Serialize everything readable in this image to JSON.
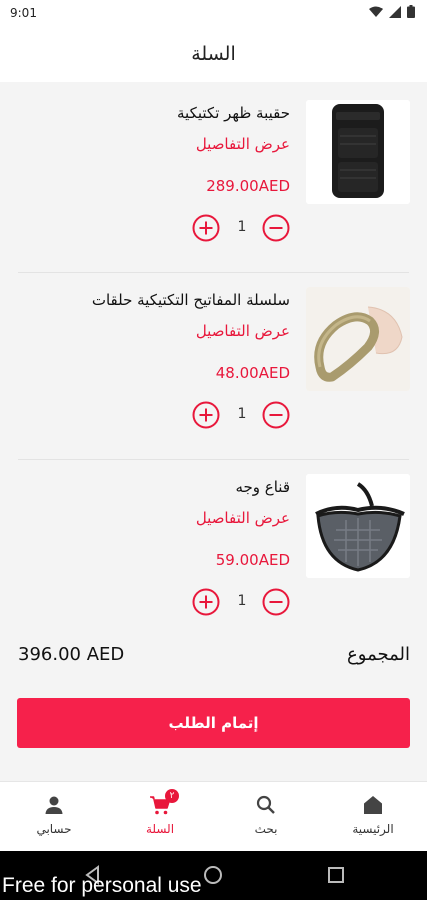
{
  "status_bar": {
    "time": "9:01"
  },
  "header": {
    "title": "السلة"
  },
  "cart": {
    "items": [
      {
        "name": "حقيبة ظهر تكتيكية",
        "details_link": "عرض التفاصيل",
        "price": "289.00AED",
        "quantity": "1"
      },
      {
        "name": "سلسلة المفاتيح التكتيكية حلقات",
        "details_link": "عرض التفاصيل",
        "price": "48.00AED",
        "quantity": "1"
      },
      {
        "name": "قناع وجه",
        "details_link": "عرض التفاصيل",
        "price": "59.00AED",
        "quantity": "1"
      }
    ],
    "total_label": "المجموع",
    "total_value": "396.00 AED",
    "checkout_label": "إتمام الطلب"
  },
  "bottom_nav": {
    "items": [
      {
        "label": "الرئيسية",
        "icon": "home-icon"
      },
      {
        "label": "بحث",
        "icon": "search-icon"
      },
      {
        "label": "السلة",
        "icon": "cart-icon",
        "badge": "٢",
        "active": true
      },
      {
        "label": "حسابي",
        "icon": "person-icon"
      }
    ]
  },
  "watermark": "Free for personal use",
  "colors": {
    "accent": "#e8173b",
    "button": "#f6214b",
    "background": "#f4f4f4"
  }
}
